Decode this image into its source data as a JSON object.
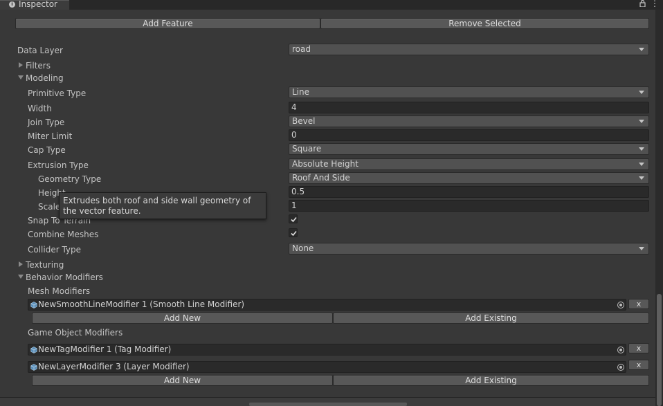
{
  "tab": {
    "title": "Inspector"
  },
  "toolbar": {
    "add_feature": "Add Feature",
    "remove_selected": "Remove Selected"
  },
  "data_layer": {
    "label": "Data Layer",
    "value": "road"
  },
  "filters": {
    "label": "Filters"
  },
  "modeling": {
    "label": "Modeling",
    "primitive_type": {
      "label": "Primitive Type",
      "value": "Line"
    },
    "width": {
      "label": "Width",
      "value": "4"
    },
    "join_type": {
      "label": "Join Type",
      "value": "Bevel"
    },
    "miter_limit": {
      "label": "Miter Limit",
      "value": "0"
    },
    "cap_type": {
      "label": "Cap Type",
      "value": "Square"
    },
    "extrusion_type": {
      "label": "Extrusion Type",
      "value": "Absolute Height"
    },
    "geometry_type": {
      "label": "Geometry Type",
      "value": "Roof And Side"
    },
    "height": {
      "label": "Height",
      "value": "0.5"
    },
    "scale": {
      "label": "Scale",
      "value": "1"
    },
    "snap_to_terrain": {
      "label": "Snap To Terrain",
      "checked": true
    },
    "combine_meshes": {
      "label": "Combine Meshes",
      "checked": true
    },
    "collider_type": {
      "label": "Collider Type",
      "value": "None"
    }
  },
  "tooltip": {
    "text": "Extrudes both roof and side wall geometry of the vector feature."
  },
  "texturing": {
    "label": "Texturing"
  },
  "behavior_modifiers": {
    "label": "Behavior Modifiers",
    "mesh_modifiers": {
      "label": "Mesh Modifiers",
      "items": [
        {
          "name": "NewSmoothLineModifier 1 (Smooth Line Modifier)",
          "remove": "x"
        }
      ],
      "add_new": "Add New",
      "add_existing": "Add Existing"
    },
    "game_object_modifiers": {
      "label": "Game Object Modifiers",
      "items": [
        {
          "name": "NewTagModifier 1 (Tag Modifier)",
          "remove": "x"
        },
        {
          "name": "NewLayerModifier 3 (Layer Modifier)",
          "remove": "x"
        }
      ],
      "add_new": "Add New",
      "add_existing": "Add Existing"
    }
  },
  "icons": {
    "info": "info-icon",
    "lock": "lock-icon",
    "menu": "kebab-menu-icon",
    "cube": "cube-icon",
    "target": "object-picker-icon"
  },
  "colors": {
    "background": "#383838",
    "header": "#282828",
    "field": "#2a2a2a",
    "button": "#585858"
  }
}
